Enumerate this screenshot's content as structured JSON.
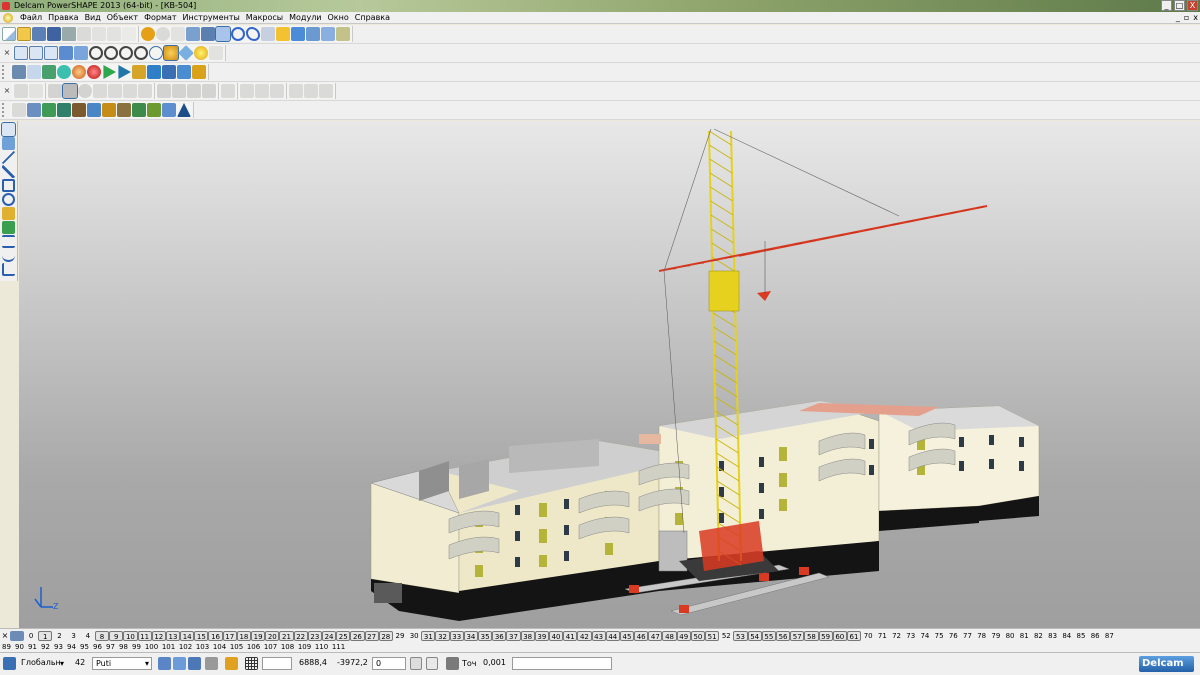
{
  "window": {
    "title": "Delcam PowerSHAPE 2013 (64-bit) - [КВ-504]",
    "buttons": [
      "_",
      "□",
      "X"
    ]
  },
  "menu": {
    "items": [
      "Файл",
      "Правка",
      "Вид",
      "Объект",
      "Формат",
      "Инструменты",
      "Макросы",
      "Модули",
      "Окно",
      "Справка"
    ],
    "mdi_buttons": [
      "_",
      "▫",
      "x"
    ]
  },
  "levels": {
    "row1": [
      "0",
      "1",
      "2",
      "3",
      "4",
      "8",
      "9",
      "10",
      "11",
      "12",
      "13",
      "14",
      "15",
      "16",
      "17",
      "18",
      "19",
      "20",
      "21",
      "22",
      "23",
      "24",
      "25",
      "26",
      "27",
      "28",
      "29",
      "30",
      "31",
      "32",
      "33",
      "34",
      "35",
      "36",
      "37",
      "38",
      "39",
      "40",
      "41",
      "42",
      "43",
      "44",
      "45",
      "46",
      "47",
      "48",
      "49",
      "50",
      "51",
      "52",
      "53",
      "54",
      "55",
      "56",
      "57",
      "58",
      "59",
      "60",
      "61",
      "70",
      "71",
      "72",
      "73",
      "74",
      "75",
      "76",
      "77",
      "78",
      "79",
      "80",
      "81",
      "82",
      "83",
      "84",
      "85",
      "86",
      "87"
    ],
    "row1_on": [
      "1",
      "8",
      "9",
      "10",
      "11",
      "12",
      "13",
      "14",
      "15",
      "16",
      "17",
      "18",
      "19",
      "20",
      "21",
      "22",
      "23",
      "24",
      "25",
      "26",
      "27",
      "28",
      "31",
      "32",
      "33",
      "34",
      "35",
      "36",
      "37",
      "38",
      "39",
      "40",
      "41",
      "42",
      "43",
      "44",
      "45",
      "46",
      "47",
      "48",
      "49",
      "50",
      "51",
      "53",
      "54",
      "55",
      "56",
      "57",
      "58",
      "59",
      "60",
      "61"
    ],
    "row2": [
      "89",
      "90",
      "91",
      "92",
      "93",
      "94",
      "95",
      "96",
      "97",
      "98",
      "99",
      "100",
      "101",
      "102",
      "103",
      "104",
      "105",
      "106",
      "107",
      "108",
      "109",
      "110",
      "111"
    ]
  },
  "statusbar": {
    "workplane": "Глобальн",
    "level_number": "42",
    "level_name": "Puti",
    "x": "6888,4",
    "y": "-3972,2",
    "z": "0",
    "tolerance_label": "Точ",
    "tolerance": "0,001",
    "brand": "Delcam"
  },
  "colors": {
    "crane_mast": "#e6d21e",
    "crane_jib": "#d93a22",
    "wall": "#f1ecd2",
    "accent_panel": "#b4b43a",
    "ground": "#111111",
    "roof": "#d9d9d9"
  }
}
